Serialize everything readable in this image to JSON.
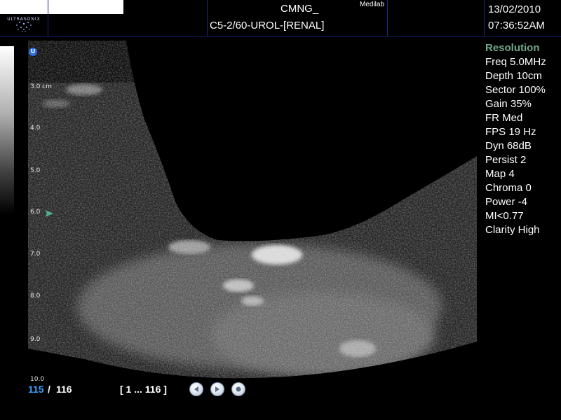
{
  "header": {
    "brand": "ULTRASONIX",
    "hospital": "CMNG_",
    "lab": "Medilab",
    "probe": "C5-2/60-UROL-[RENAL]",
    "date": "13/02/2010",
    "time": "07:36:52AM"
  },
  "depth_scale": {
    "labels": [
      "3.0 cm",
      "4.0",
      "5.0",
      "6.0",
      "7.0",
      "8.0",
      "9.0",
      "10.0"
    ]
  },
  "orientation_marker": "U",
  "params": {
    "heading": "Resolution",
    "items": [
      "Freq 5.0MHz",
      "Depth 10cm",
      "Sector 100%",
      "Gain 35%",
      "FR Med",
      "FPS 19 Hz",
      "Dyn 68dB",
      "Persist 2",
      "Map 4",
      "Chroma 0",
      "Power -4",
      "MI<0.77",
      "Clarity High"
    ]
  },
  "playback": {
    "current_frame": "115",
    "separator": "/",
    "total_frames": "116",
    "range": "[ 1 ... 116 ]",
    "buttons": [
      "rewind-icon",
      "play-icon",
      "record-icon"
    ]
  },
  "colors": {
    "frame_highlight": "#3aa0ff",
    "param_heading": "#6fa88a",
    "focal_marker": "#4fb38a",
    "orientation_marker": "#2f6fe0"
  }
}
